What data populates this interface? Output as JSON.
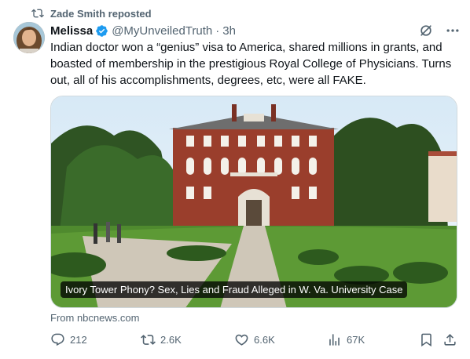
{
  "repost": {
    "text": "Zade Smith reposted",
    "icon": "repost-icon"
  },
  "author": {
    "name": "Melissa",
    "handle": "@MyUnveiledTruth",
    "time": "3h",
    "verified_color": "#1d9bf0"
  },
  "tweet": {
    "text": "Indian doctor won a “genius” visa to America, shared millions in grants, and boasted of membership in the prestigious Royal College of Physicians. Turns out, all of his accomplishments, degrees, etc, were all FAKE."
  },
  "card": {
    "caption": "Ivory Tower Phony? Sex, Lies and Fraud Alleged in W. Va. University Case",
    "source": "From nbcnews.com"
  },
  "actions": {
    "replies": "212",
    "reposts": "2.6K",
    "likes": "6.6K",
    "views": "67K"
  },
  "colors": {
    "text_primary": "#0f1419",
    "text_secondary": "#536471",
    "accent": "#1d9bf0"
  }
}
